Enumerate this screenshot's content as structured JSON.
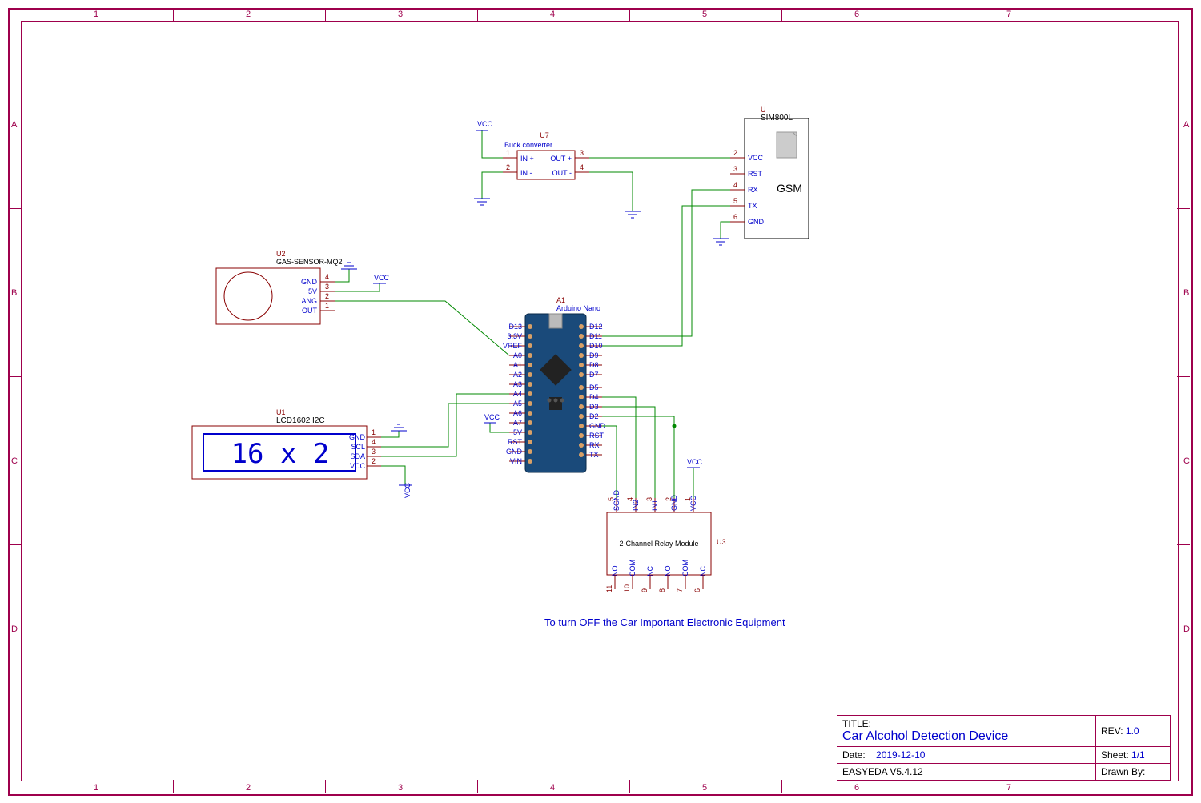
{
  "frame": {
    "cols": [
      "1",
      "2",
      "3",
      "4",
      "5",
      "6",
      "7"
    ],
    "rows": [
      "A",
      "B",
      "C",
      "D"
    ]
  },
  "components": {
    "buck": {
      "ref": "U7",
      "name": "Buck converter",
      "pins": {
        "1": "IN +",
        "2": "IN -",
        "3": "OUT +",
        "4": "OUT -"
      }
    },
    "gsm": {
      "ref": "U",
      "name": "SIM800L",
      "label": "GSM",
      "pins": {
        "2": "VCC",
        "3": "RST",
        "4": "RX",
        "5": "TX",
        "6": "GND"
      }
    },
    "gas": {
      "ref": "U2",
      "name": "GAS-SENSOR-MQ2",
      "pins": {
        "4": "GND",
        "3": "5V",
        "2": "ANG",
        "1": "OUT"
      }
    },
    "lcd": {
      "ref": "U1",
      "name": "LCD1602 I2C",
      "display": "16 x 2",
      "pins": {
        "1": "GND",
        "4": "SCL",
        "3": "SDA",
        "2": "VCC"
      }
    },
    "arduino": {
      "ref": "A1",
      "name": "Arduino Nano",
      "left": [
        "D13",
        "3.3V",
        "VREF",
        "A0",
        "A1",
        "A2",
        "A3",
        "A4",
        "A5",
        "A6",
        "A7",
        "5V",
        "RST",
        "GND",
        "VIN"
      ],
      "right": [
        "D12",
        "D11",
        "D10",
        "D9",
        "D8",
        "D7",
        "",
        "D5",
        "D4",
        "D3",
        "D2",
        "GND",
        "RST",
        "RX",
        "TX"
      ]
    },
    "relay": {
      "ref": "U3",
      "name": "2-Channel Relay Module",
      "top": {
        "5": "SGND",
        "4": "IN2",
        "3": "IN1",
        "2": "GND",
        "1": "VCC"
      },
      "bot": {
        "11": "NO",
        "10": "COM",
        "9": "NC",
        "8": "NO",
        "7": "COM",
        "6": "NC"
      }
    }
  },
  "netlabels": {
    "vcc": "VCC"
  },
  "note": "To turn OFF the Car Important Electronic Equipment",
  "titleblock": {
    "title_label": "TITLE:",
    "title": "Car Alcohol Detection Device",
    "rev_label": "REV:",
    "rev": "1.0",
    "date_label": "Date:",
    "date": "2019-12-10",
    "sheet_label": "Sheet:",
    "sheet": "1/1",
    "company": "EASYEDA V5.4.12",
    "drawn_label": "Drawn By:",
    "drawn": ""
  }
}
